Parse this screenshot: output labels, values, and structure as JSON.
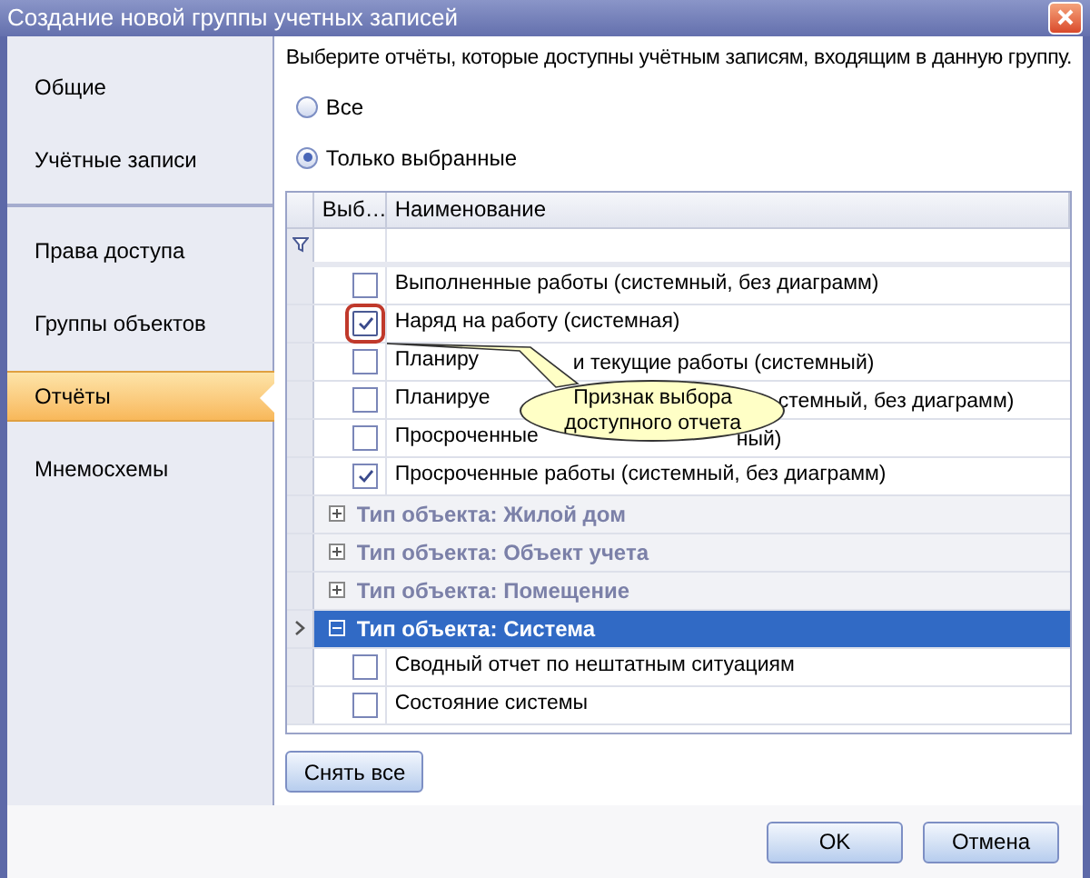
{
  "window": {
    "title": "Создание новой группы учетных записей"
  },
  "sidebar": {
    "items": [
      {
        "label": "Общие",
        "selected": false,
        "divider_after": false
      },
      {
        "label": "Учётные записи",
        "selected": false,
        "divider_after": true
      },
      {
        "label": "Права доступа",
        "selected": false,
        "divider_after": false
      },
      {
        "label": "Группы объектов",
        "selected": false,
        "divider_after": false
      },
      {
        "label": "Отчёты",
        "selected": true,
        "divider_after": false
      },
      {
        "label": "Мнемосхемы",
        "selected": false,
        "divider_after": false
      }
    ]
  },
  "instruction": "Выберите отчёты, которые доступны учётным записям, входящим в данную группу.",
  "radios": [
    {
      "label": "Все",
      "selected": false
    },
    {
      "label": "Только выбранные",
      "selected": true
    }
  ],
  "grid": {
    "columns": [
      "Выб…",
      "Наименование"
    ],
    "rows": [
      {
        "kind": "report",
        "checked": false,
        "selected": false,
        "parts": [
          "Выполненные работы (системный, без диаграмм)"
        ]
      },
      {
        "kind": "report",
        "checked": true,
        "selected": false,
        "parts": [
          "Наряд на работу (системная)"
        ]
      },
      {
        "kind": "report",
        "checked": false,
        "selected": false,
        "parts": [
          "Планиру",
          "и текущие работы (системный)"
        ]
      },
      {
        "kind": "report",
        "checked": false,
        "selected": false,
        "parts": [
          "Планируе",
          "стемный, без диаграмм)"
        ]
      },
      {
        "kind": "report",
        "checked": false,
        "selected": false,
        "parts": [
          "Просроченные",
          "ный)"
        ]
      },
      {
        "kind": "report",
        "checked": true,
        "selected": false,
        "parts": [
          "Просроченные работы (системный, без диаграмм)"
        ]
      },
      {
        "kind": "group",
        "expanded": false,
        "selected": false,
        "label": "Тип объекта: Жилой дом"
      },
      {
        "kind": "group",
        "expanded": false,
        "selected": false,
        "label": "Тип объекта: Объект учета"
      },
      {
        "kind": "group",
        "expanded": false,
        "selected": false,
        "label": "Тип объекта: Помещение"
      },
      {
        "kind": "group",
        "expanded": true,
        "selected": true,
        "label": "Тип объекта: Система",
        "children": [
          {
            "kind": "report",
            "checked": false,
            "selected": false,
            "parts": [
              "Сводный отчет по нештатным ситуациям"
            ]
          },
          {
            "kind": "report",
            "checked": false,
            "selected": false,
            "parts": [
              "Состояние системы"
            ]
          }
        ]
      }
    ]
  },
  "callout": "Признак выбора\nдоступного отчета",
  "clear_button": "Снять все",
  "buttons": [
    "OK",
    "Отмена"
  ]
}
